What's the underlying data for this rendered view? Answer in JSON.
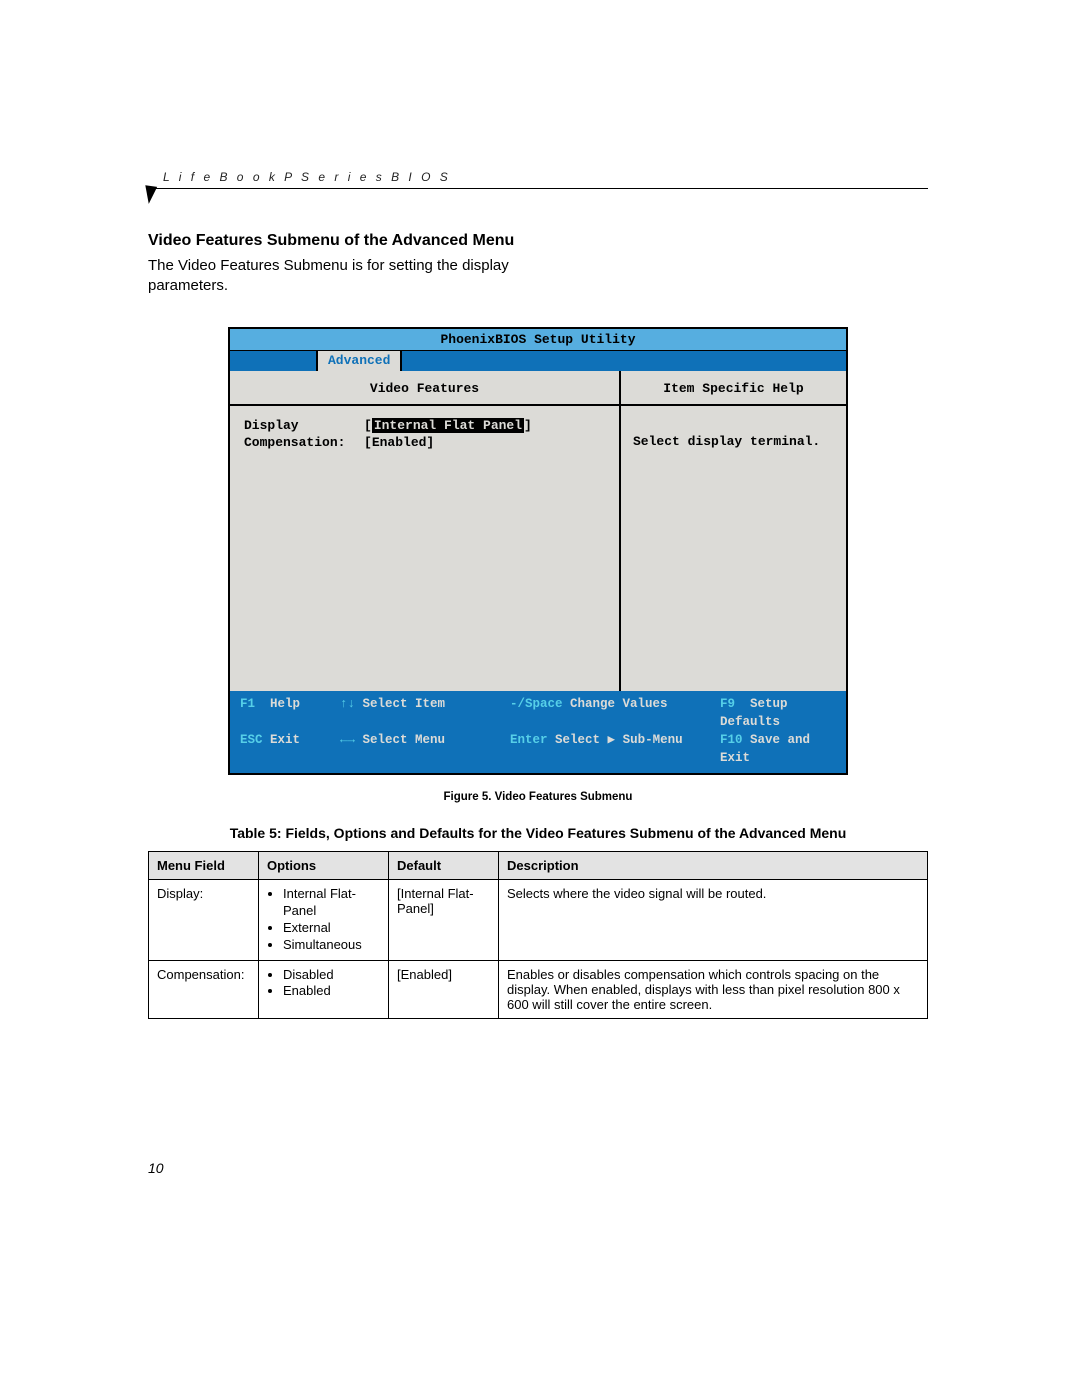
{
  "header": {
    "running_head": "L i f e B o o k   P   S e r i e s   B I O S"
  },
  "section": {
    "title": "Video Features Submenu of the Advanced Menu",
    "intro": "The Video Features Submenu is for setting the display parameters."
  },
  "bios": {
    "title": "PhoenixBIOS Setup Utility",
    "active_tab": "Advanced",
    "panel_title": "Video Features",
    "help_title": "Item Specific Help",
    "rows": [
      {
        "label": "Display",
        "value": "Internal Flat Panel",
        "highlight": true
      },
      {
        "label": "Compensation:",
        "value": "Enabled",
        "highlight": false
      }
    ],
    "help_text": "Select display terminal.",
    "footer": [
      [
        {
          "key": "F1",
          "label": "Help"
        },
        {
          "key": "↑↓",
          "label": "Select Item"
        },
        {
          "key": "-/Space",
          "label": "Change Values"
        },
        {
          "key": "F9",
          "label": "Setup Defaults"
        }
      ],
      [
        {
          "key": "ESC",
          "label": "Exit"
        },
        {
          "key": "←→",
          "label": "Select Menu"
        },
        {
          "key": "Enter",
          "label": "Select ▶ Sub-Menu"
        },
        {
          "key": "F10",
          "label": "Save and Exit"
        }
      ]
    ]
  },
  "caption": "Figure 5.  Video Features Submenu",
  "table": {
    "title": "Table 5: Fields, Options and Defaults for the Video Features Submenu of the Advanced Menu",
    "headers": [
      "Menu Field",
      "Options",
      "Default",
      "Description"
    ],
    "rows": [
      {
        "field": "Display:",
        "options": [
          "Internal Flat-Panel",
          "External",
          "Simultaneous"
        ],
        "default": "[Internal Flat-Panel]",
        "desc": "Selects where the video signal will be routed."
      },
      {
        "field": "Compensation:",
        "options": [
          "Disabled",
          "Enabled"
        ],
        "default": "[Enabled]",
        "desc": "Enables or disables compensation which controls spacing on the display. When enabled, displays with less than pixel resolution 800 x 600 will still cover the entire screen."
      }
    ]
  },
  "page_number": "10"
}
